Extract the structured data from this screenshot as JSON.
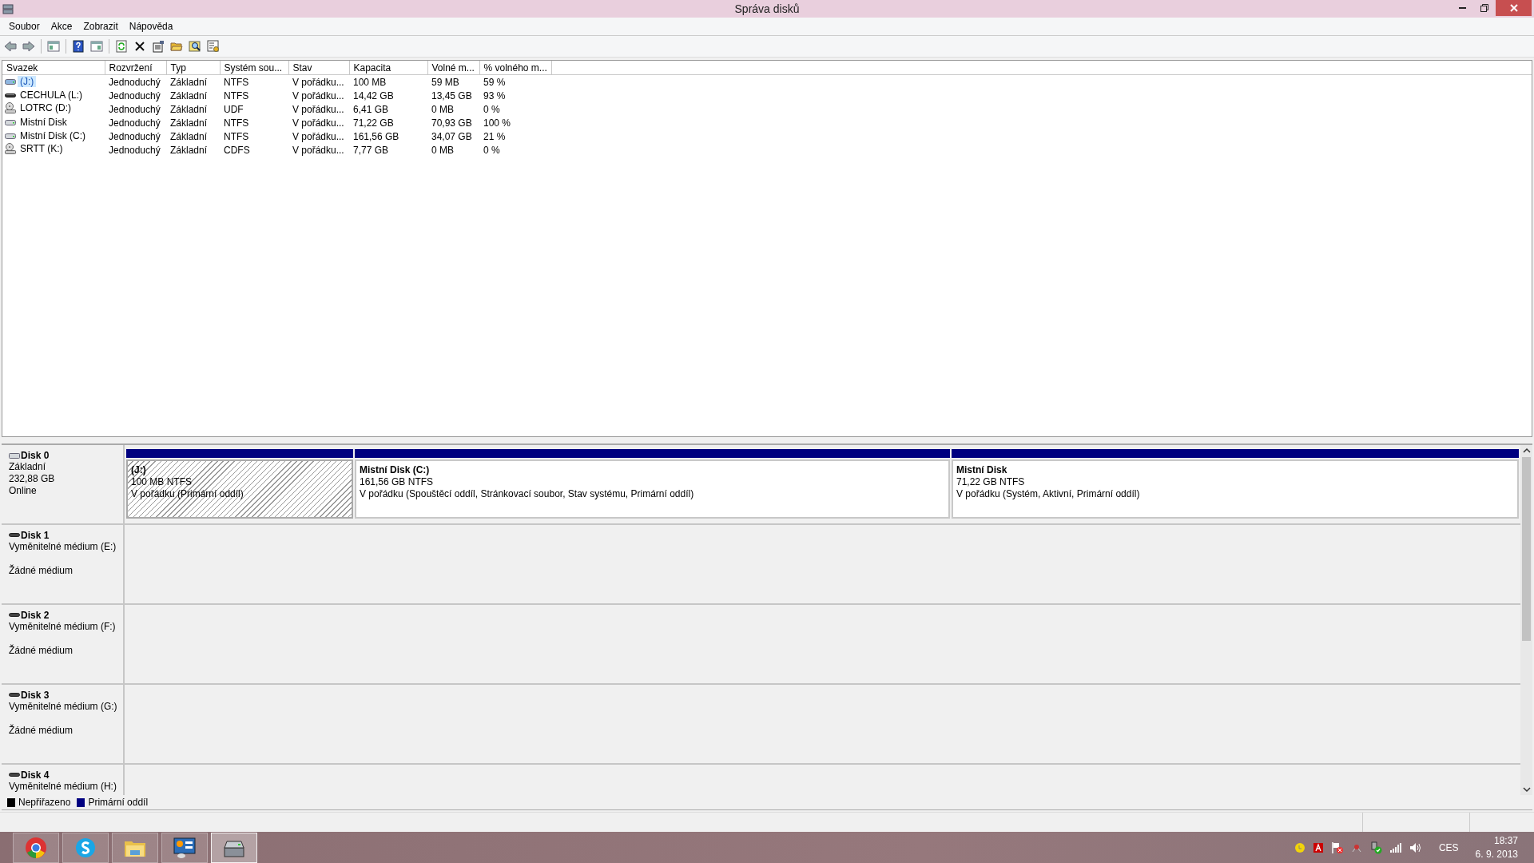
{
  "window": {
    "title": "Správa disků"
  },
  "menu": [
    "Soubor",
    "Akce",
    "Zobrazit",
    "Nápověda"
  ],
  "table": {
    "columns": [
      "Svazek",
      "Rozvržení",
      "Typ",
      "Systém sou...",
      "Stav",
      "Kapacita",
      "Volné m...",
      "% volného m..."
    ],
    "rows": [
      {
        "kind": "hdd",
        "selected": true,
        "cells": [
          "(J:)",
          "Jednoduchý",
          "Základní",
          "NTFS",
          "V pořádku...",
          "100 MB",
          "59 MB",
          "59 %"
        ]
      },
      {
        "kind": "removable",
        "selected": false,
        "cells": [
          "CECHULA (L:)",
          "Jednoduchý",
          "Základní",
          "NTFS",
          "V pořádku...",
          "14,42 GB",
          "13,45 GB",
          "93 %"
        ]
      },
      {
        "kind": "optical",
        "selected": false,
        "cells": [
          "LOTRC (D:)",
          "Jednoduchý",
          "Základní",
          "UDF",
          "V pořádku...",
          "6,41 GB",
          "0 MB",
          "0 %"
        ]
      },
      {
        "kind": "hdd",
        "selected": false,
        "cells": [
          "Mistní Disk",
          "Jednoduchý",
          "Základní",
          "NTFS",
          "V pořádku...",
          "71,22 GB",
          "70,93 GB",
          "100 %"
        ]
      },
      {
        "kind": "hdd",
        "selected": false,
        "cells": [
          "Mistní Disk (C:)",
          "Jednoduchý",
          "Základní",
          "NTFS",
          "V pořádku...",
          "161,56 GB",
          "34,07 GB",
          "21 %"
        ]
      },
      {
        "kind": "optical",
        "selected": false,
        "cells": [
          "SRTT (K:)",
          "Jednoduchý",
          "Základní",
          "CDFS",
          "V pořádku...",
          "7,77 GB",
          "0 MB",
          "0 %"
        ]
      }
    ]
  },
  "disks": [
    {
      "kind": "basic",
      "name": "Disk 0",
      "lines": [
        "Základní",
        "232,88 GB",
        "Online"
      ],
      "partitions": [
        {
          "name": "(J:)",
          "size": "100 MB NTFS",
          "status": "V pořádku (Primární oddíl)",
          "selected": true
        },
        {
          "name": "Mistní Disk  (C:)",
          "size": "161,56 GB NTFS",
          "status": "V pořádku (Spouštěcí oddíl, Stránkovací soubor, Stav systému, Primární oddíl)",
          "selected": false
        },
        {
          "name": "Mistní Disk",
          "size": "71,22 GB NTFS",
          "status": "V pořádku (Systém, Aktivní, Primární oddíl)",
          "selected": false
        }
      ]
    },
    {
      "kind": "removable",
      "name": "Disk 1",
      "lines": [
        "Vyměnitelné médium (E:)"
      ],
      "note": "Žádné médium"
    },
    {
      "kind": "removable",
      "name": "Disk 2",
      "lines": [
        "Vyměnitelné médium (F:)"
      ],
      "note": "Žádné médium"
    },
    {
      "kind": "removable",
      "name": "Disk 3",
      "lines": [
        "Vyměnitelné médium (G:)"
      ],
      "note": "Žádné médium"
    },
    {
      "kind": "removable",
      "name": "Disk 4",
      "lines": [
        "Vyměnitelné médium (H:)"
      ]
    }
  ],
  "legend": [
    {
      "label": "Nepřiřazeno",
      "color": "#000000"
    },
    {
      "label": "Primární oddíl",
      "color": "#000080"
    }
  ],
  "taskbar": {
    "apps": [
      {
        "kind": "browser",
        "selected": false
      },
      {
        "kind": "chat",
        "selected": false
      },
      {
        "kind": "folder",
        "selected": false
      },
      {
        "kind": "panel",
        "selected": false
      },
      {
        "kind": "disk",
        "selected": true
      }
    ],
    "language": "CES",
    "time": "18:37",
    "date": "6. 9. 2013"
  }
}
